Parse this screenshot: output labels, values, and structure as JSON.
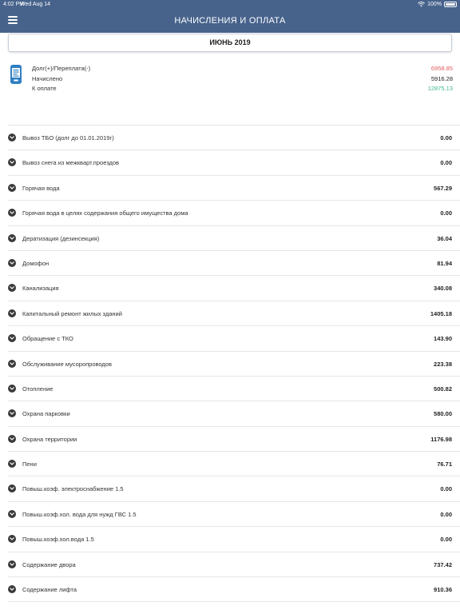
{
  "status_bar": {
    "time": "4:02 PM",
    "date": "Wed Aug 14",
    "battery": "100%"
  },
  "header": {
    "title": "НАЧИСЛЕНИЯ И ОПЛАТА"
  },
  "period": {
    "label": "ИЮНЬ 2019"
  },
  "summary": {
    "debt_label": "Долг(+)/Переплата(-)",
    "debt_value": "6958.85",
    "charged_label": "Начислено",
    "charged_value": "5916.28",
    "to_pay_label": "К оплате",
    "to_pay_value": "12875.13"
  },
  "colors": {
    "header": "#47638c",
    "debt": "#e05a5a",
    "to_pay": "#3fb78a"
  },
  "items": [
    {
      "name": "Вывоз ТБО (долг до 01.01.2019г)",
      "amount": "0.00"
    },
    {
      "name": "Вывоз снега из межкварт.проездов",
      "amount": "0.00"
    },
    {
      "name": "Горячая вода",
      "amount": "567.29"
    },
    {
      "name": "Горячая вода в целях содержания общего имущества дома",
      "amount": "0.00"
    },
    {
      "name": "Дератизация (дезинсекция)",
      "amount": "36.04"
    },
    {
      "name": "Домофон",
      "amount": "81.94"
    },
    {
      "name": "Канализация",
      "amount": "340.08"
    },
    {
      "name": "Капитальный ремонт жилых зданий",
      "amount": "1405.18"
    },
    {
      "name": "Обращение с ТКО",
      "amount": "143.90"
    },
    {
      "name": "Обслуживание мусоропроводов",
      "amount": "223.38"
    },
    {
      "name": "Отопление",
      "amount": "500.82"
    },
    {
      "name": "Охрана парковки",
      "amount": "580.00"
    },
    {
      "name": "Охрана территории",
      "amount": "1176.98"
    },
    {
      "name": "Пени",
      "amount": "76.71"
    },
    {
      "name": "Повыш.коэф. электроснабжение 1.5",
      "amount": "0.00"
    },
    {
      "name": "Повыш.коэф.хол. вода для нужд ГВС 1.5",
      "amount": "0.00"
    },
    {
      "name": "Повыш.коэф.хол.вода 1.5",
      "amount": "0.00"
    },
    {
      "name": "Содержание двора",
      "amount": "737.42"
    },
    {
      "name": "Содержание лифта",
      "amount": "910.36"
    }
  ]
}
